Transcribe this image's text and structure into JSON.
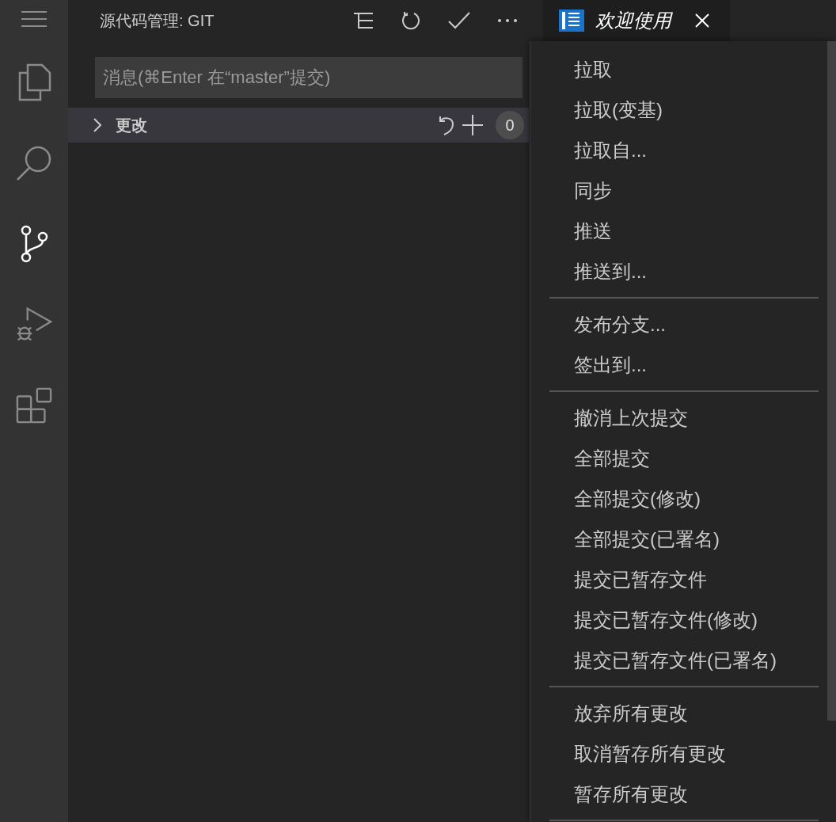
{
  "activity_bar": {
    "items": [
      {
        "kind": "explorer",
        "selected": false
      },
      {
        "kind": "search",
        "selected": false
      },
      {
        "kind": "scm",
        "selected": true
      },
      {
        "kind": "debug",
        "selected": false
      },
      {
        "kind": "extensions",
        "selected": false
      }
    ]
  },
  "side_bar": {
    "title": "源代码管理: GIT",
    "commit_input": {
      "placeholder": "消息(⌘Enter 在“master”提交)"
    },
    "changes_section": {
      "label": "更改",
      "expanded": false,
      "count": "0"
    }
  },
  "editor_tab": {
    "title": "欢迎使用"
  },
  "context_menu": {
    "items": [
      {
        "kind": "item",
        "label": "拉取"
      },
      {
        "kind": "item",
        "label": "拉取(变基)"
      },
      {
        "kind": "item",
        "label": "拉取自..."
      },
      {
        "kind": "item",
        "label": "同步"
      },
      {
        "kind": "item",
        "label": "推送"
      },
      {
        "kind": "item",
        "label": "推送到..."
      },
      {
        "kind": "separator"
      },
      {
        "kind": "item",
        "label": "发布分支..."
      },
      {
        "kind": "item",
        "label": "签出到..."
      },
      {
        "kind": "separator"
      },
      {
        "kind": "item",
        "label": "撤消上次提交"
      },
      {
        "kind": "item",
        "label": "全部提交"
      },
      {
        "kind": "item",
        "label": "全部提交(修改)"
      },
      {
        "kind": "item",
        "label": "全部提交(已署名)"
      },
      {
        "kind": "item",
        "label": "提交已暂存文件"
      },
      {
        "kind": "item",
        "label": "提交已暂存文件(修改)"
      },
      {
        "kind": "item",
        "label": "提交已暂存文件(已署名)"
      },
      {
        "kind": "separator"
      },
      {
        "kind": "item",
        "label": "放弃所有更改"
      },
      {
        "kind": "item",
        "label": "取消暂存所有更改"
      },
      {
        "kind": "item",
        "label": "暂存所有更改"
      },
      {
        "kind": "separator"
      }
    ]
  }
}
